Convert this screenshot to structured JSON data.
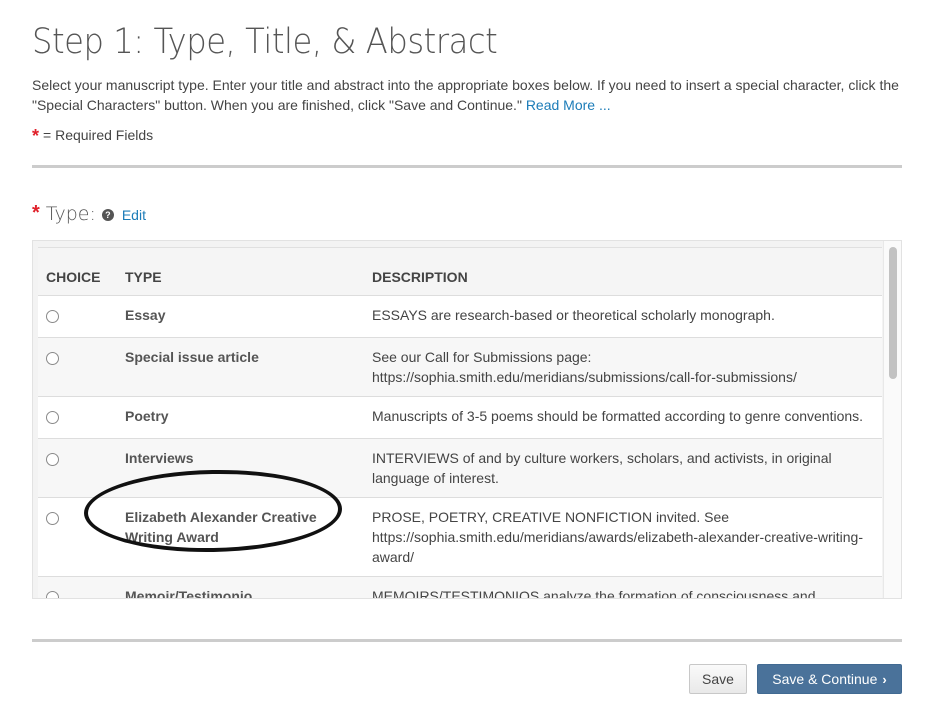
{
  "header": {
    "title": "Step 1: Type, Title, & Abstract",
    "instructions": "Select your manuscript type. Enter your title and abstract into the appropriate boxes below. If you need to insert a special character, click the \"Special Characters\" button. When you are finished, click \"Save and Continue.\"",
    "read_more_label": "Read More ...",
    "required_star": "*",
    "required_note": "= Required Fields"
  },
  "type_section": {
    "required_star": "*",
    "label": "Type:",
    "help_icon": "?",
    "edit_label": "Edit"
  },
  "table": {
    "columns": [
      "CHOICE",
      "TYPE",
      "DESCRIPTION"
    ],
    "rows": [
      {
        "type": "Essay",
        "description": "ESSAYS are research-based or theoretical scholarly monograph.",
        "selected": false
      },
      {
        "type": "Special issue article",
        "description": "See our Call for Submissions page: https://sophia.smith.edu/meridians/submissions/call-for-submissions/",
        "selected": false
      },
      {
        "type": "Poetry",
        "description": "Manuscripts of 3-5 poems should be formatted according to genre conventions.",
        "selected": false
      },
      {
        "type": "Interviews",
        "description": "INTERVIEWS of and by culture workers, scholars, and activists, in original language of interest.",
        "selected": false
      },
      {
        "type": "Elizabeth Alexander Creative Writing Award",
        "description": "PROSE, POETRY, CREATIVE NONFICTION invited. See https://sophia.smith.edu/meridians/awards/elizabeth-alexander-creative-writing-award/",
        "selected": false,
        "annotated": true
      },
      {
        "type": "Memoir/Testimonio",
        "description": "MEMOIRS/TESTIMONIOS analyze the formation of consciousness and examines the production of racial, sexual, and national subjects.",
        "selected": false
      }
    ]
  },
  "footer": {
    "save_label": "Save",
    "save_continue_label": "Save & Continue",
    "save_continue_icon": "›"
  },
  "colors": {
    "link": "#1c7cb8",
    "required": "#e0202a",
    "primary_button": "#4a729a"
  }
}
